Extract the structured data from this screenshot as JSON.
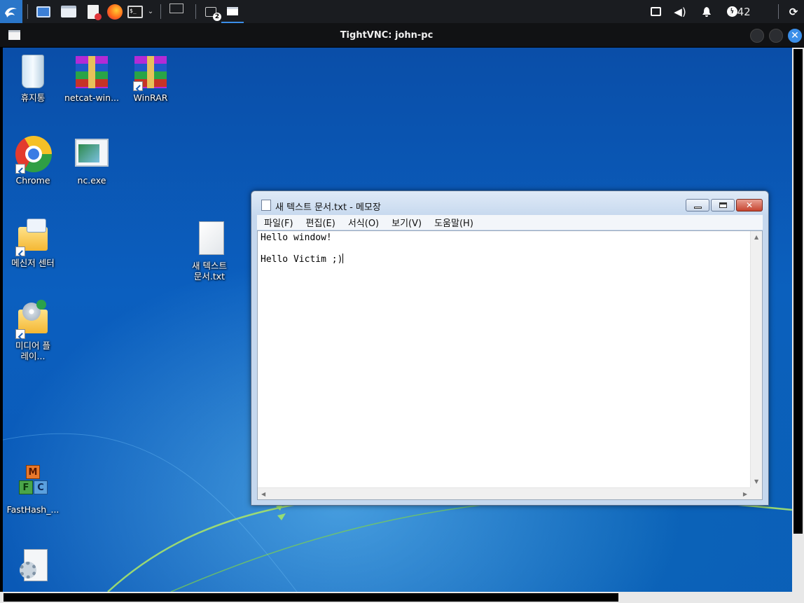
{
  "top_panel": {
    "clock": "1:42",
    "workspace_badge": "2",
    "terminal_prompt": "$_"
  },
  "vnc": {
    "title": "TightVNC: john-pc",
    "close_glyph": "✕"
  },
  "desktop": {
    "icons": [
      {
        "label": "휴지통"
      },
      {
        "label": "netcat-win..."
      },
      {
        "label": "WinRAR"
      },
      {
        "label": "Chrome"
      },
      {
        "label": "nc.exe"
      },
      {
        "label": "메신저 센터"
      },
      {
        "label": "새 텍스트 문서.txt"
      },
      {
        "label": "미디어 플레이..."
      },
      {
        "label": "FastHash_..."
      }
    ]
  },
  "notepad": {
    "title": "새 텍스트 문서.txt - 메모장",
    "menus": [
      "파일(F)",
      "편집(E)",
      "서식(O)",
      "보기(V)",
      "도움말(H)"
    ],
    "lines": [
      "Hello window!",
      "",
      "Hello Victim ;)"
    ],
    "controls": {
      "minimize": "–",
      "maximize": "□",
      "close": "✕"
    }
  },
  "colors": {
    "panel_bg": "#1a1c20",
    "kali_blue": "#2a76c9",
    "desktop_blue": "#0b5fbf",
    "notepad_frame": "#c6d8ee"
  }
}
